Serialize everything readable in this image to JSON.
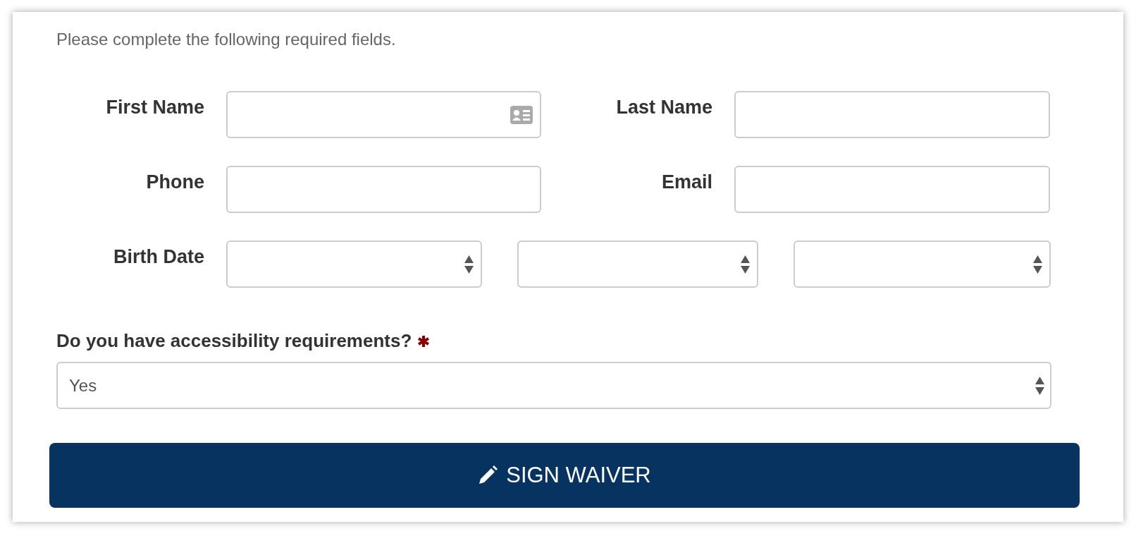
{
  "instructions": "Please complete the following required fields.",
  "fields": [
    {
      "label": "First Name",
      "kind": "contact"
    },
    {
      "label": "Last Name",
      "kind": "text"
    },
    {
      "label": "Phone",
      "kind": "text"
    },
    {
      "label": "Email",
      "kind": "text"
    },
    {
      "label": "Birth Date",
      "kind": "date"
    }
  ],
  "question": {
    "label": "Do you have accessibility requirements?",
    "required": true,
    "value": "Yes"
  },
  "button": {
    "label": "SIGN WAIVER"
  }
}
